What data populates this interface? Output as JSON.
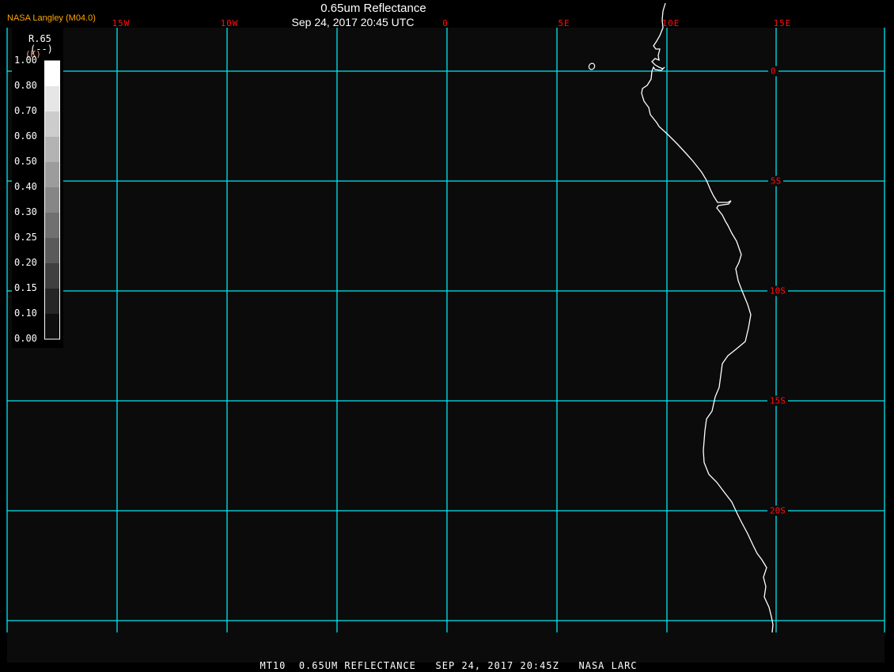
{
  "header": {
    "credit": "NASA Langley (M04.0)",
    "title": "0.65um Reflectance",
    "datetime": "Sep 24, 2017 20:45 UTC"
  },
  "longitude_labels": [
    "15W",
    "10W",
    "0",
    "5E",
    "10E",
    "15E"
  ],
  "latitude_labels": [
    "0",
    "5S",
    "10S",
    "15S",
    "20S"
  ],
  "legend": {
    "name": "R.65",
    "units": "(--)",
    "sub": "(K)",
    "ticks": [
      "1.00",
      "0.80",
      "0.70",
      "0.60",
      "0.50",
      "0.40",
      "0.30",
      "0.25",
      "0.20",
      "0.15",
      "0.10",
      "0.00"
    ],
    "colors": [
      "#ffffff",
      "#e6e6e6",
      "#cccccc",
      "#b3b3b3",
      "#9c9c9c",
      "#868686",
      "#707070",
      "#5a5a5a",
      "#404040",
      "#262626",
      "#0f0f0f"
    ]
  },
  "colors": {
    "grid": "#00e8f0",
    "labels": "#ff1010",
    "coast": "#ffffff",
    "background": "#0b0b0b",
    "credit": "#ffa500"
  },
  "footer": "MT10  0.65UM REFLECTANCE   SEP 24, 2017 20:45Z   NASA LARC"
}
